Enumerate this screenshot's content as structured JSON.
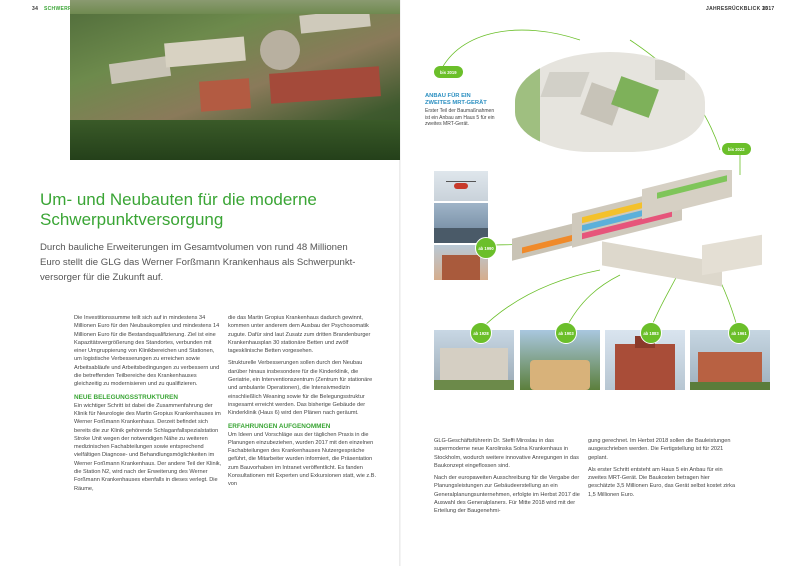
{
  "header": {
    "left_page_number": "34",
    "left_section": "SCHWERPUNKTE",
    "right_section": "JAHRESRÜCKBLICK 2017",
    "right_page_number": "35"
  },
  "article": {
    "title": "Um- und Neubauten für die moderne Schwerpunktversorgung",
    "lead": "Durch bauliche Erweiterungen im Gesamtvolumen von rund 48 Millionen Euro stellt die GLG das Werner Forßmann Krankenhaus als Schwerpunkt-versorger für die Zukunft auf.",
    "col1": {
      "p1": "Die Investitionssumme teilt sich auf in mindestens 34 Millionen Euro für den Neubaukomplex und mindestens 14 Millionen Euro für die Bestandsqualifizierung. Ziel ist eine Kapazitätsvergrößerung des Standortes, verbunden mit einer Umgruppierung von Klinikbereichen und Stationen, um logistische Verbesserungen zu erreichen sowie Arbeitsabläufe und Arbeitsbedingungen zu verbessern und die betreffenden Teilbereiche des Krankenhauses gleichzeitig zu modernisieren und zu qualifizieren.",
      "h1": "NEUE BELEGUNGSSTRUKTUREN",
      "p2": "Ein wichtiger Schritt ist dabei die Zusammenfahrung der Klinik für Neurologie des Martin Gropius Krankenhauses im Werner Forßmann Krankenhaus. Derzeit befindet sich bereits die zur Klinik gehörende Schlaganfallspezialstation Stroke Unit wegen der notwendigen Nähe zu weiteren medizinischen Fachabteilungen sowie entsprechend vielfältigen Diagnose- und Behandlungsmöglichkeiten im Werner Forßmann Krankenhaus. Der andere Teil der Klinik, die Station N2, wird nach der Erweiterung des Werner Forßmann Krankenhauses ebenfalls in dieses verlegt. Die Räume,"
    },
    "col2": {
      "p1": "die das Martin Gropius Krankenhaus dadurch gewinnt, kommen unter anderem dem Ausbau der Psychosomatik zugute. Dafür sind laut Zusatz zum dritten Brandenburger Krankenhausplan 30 stationäre Betten und zwölf tagesklinische Betten vorgesehen.",
      "p2": "Strukturelle Verbesserungen sollen durch den Neubau darüber hinaus insbesondere für die Kinderklinik, die Geriatrie, ein Interventionszentrum (Zentrum für stationäre und ambulante Operationen), die Intensivmedizin einschließlich Weaning sowie für die Belegungsstruktur insgesamt erreicht werden. Das bisherige Gebäude der Kinderklinik (Haus 6) wird den Plänen nach geräumt.",
      "h1": "ERFAHRUNGEN AUFGENOMMEN",
      "p3": "Um Ideen und Vorschläge aus der täglichen Praxis in die Planungen einzubeziehen, wurden 2017 mit den einzelnen Fachabteilungen des Krankenhauses Nutzergespräche geführt, die Mitarbeiter wurden informiert, die Präsentation zum Bauvorhaben im Intranet veröffentlicht. Es fanden Konsultationen mit Experten und Exkursionen statt, wie z.B. von"
    },
    "col3": {
      "p1": "GLG-Geschäftsführerin Dr. Steffi Miroslau in das supermoderne neue Karolinska Solna Krankenhaus in Stockholm, wodurch weitere innovative Anregungen in das Baukonzept eingeflossen sind.",
      "p2": "Nach der europaweiten Ausschreibung für die Vergabe der Planungsleistungen zur Gebäudeerstellung an ein Generalplanungsunternehmen, erfolgte im Herbst 2017 die Auswahl des Generalplaners. Für Mitte 2018 wird mit der Erteilung der Baugenehmi-"
    },
    "col4": {
      "p1": "gung gerechnet. Im Herbst 2018 sollen die Bauleistungen ausgeschrieben werden. Die Fertigstellung ist für 2021 geplant.",
      "p2": "Als erster Schritt entsteht am Haus 5 ein Anbau für ein zweites MRT-Gerät. Die Baukosten betragen hier geschätzte 3,5 Millionen Euro, das Gerät selbst kostet zirka 1,5 Millionen Euro."
    }
  },
  "infographic": {
    "caption_title": "ANBAU FÜR EIN ZWEITES MRT-GERÄT",
    "caption_text": "Erster Teil der Baumaßnahmen ist ein Anbau am Haus 5 für ein zweites MRT-Gerät.",
    "badges": {
      "b2019": "bis 2019",
      "b2022": "bis 2022",
      "b1990": "ab 1990",
      "b1928": "ab 1928",
      "b1903": "ab 1903",
      "b1883": "ab 1883",
      "b1961": "ab 1961"
    }
  },
  "colors": {
    "accent_green": "#3aa535",
    "badge_green": "#6bbf2a",
    "caption_blue": "#2b8fc1"
  }
}
